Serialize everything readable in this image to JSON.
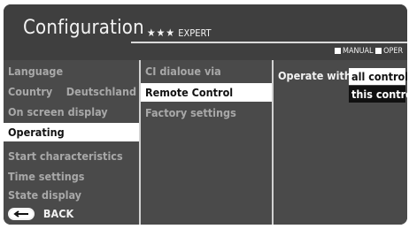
{
  "header": {
    "title": "Configuration",
    "stars": "★★★",
    "level": "EXPERT",
    "mode_manual": "MANUAL",
    "mode_oper": "OPER"
  },
  "menu": {
    "items": [
      {
        "label": "Language",
        "value": "",
        "selected": false
      },
      {
        "label": "Country",
        "value": "Deutschland",
        "selected": false
      },
      {
        "label": "On screen display",
        "value": "",
        "selected": false
      },
      {
        "label": "Operating",
        "value": "",
        "selected": true
      },
      {
        "label": "Start characteristics",
        "value": "",
        "selected": false
      },
      {
        "label": "Time settings",
        "value": "",
        "selected": false
      },
      {
        "label": "State display",
        "value": "",
        "selected": false
      }
    ]
  },
  "submenu": {
    "items": [
      {
        "label": "CI dialoue via",
        "selected": false
      },
      {
        "label": "Remote Control",
        "selected": true
      },
      {
        "label": "Factory settings",
        "selected": false
      }
    ]
  },
  "detail": {
    "label": "Operate with",
    "options": [
      {
        "label": "all controls",
        "active": false
      },
      {
        "label": "this control",
        "active": true
      }
    ]
  },
  "footer": {
    "back_label": "BACK",
    "back_icon": "back-arrow-icon"
  }
}
